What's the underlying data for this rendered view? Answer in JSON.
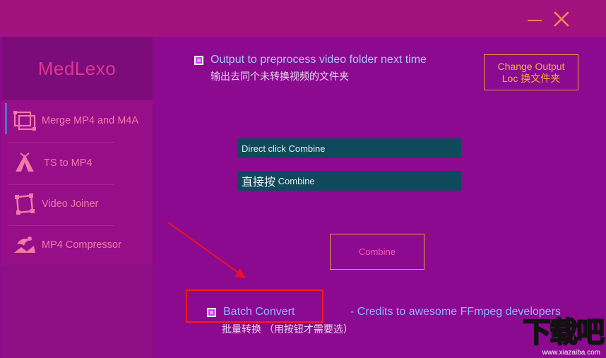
{
  "window": {
    "minimize_icon": "minimize-icon",
    "close_icon": "close-icon"
  },
  "sidebar": {
    "logo": "MedLexo",
    "items": [
      {
        "label": "Merge MP4 and M4A",
        "icon": "merge-icon",
        "active": true
      },
      {
        "label": "TS to MP4",
        "icon": "tent-icon",
        "active": false
      },
      {
        "label": "Video Joiner",
        "icon": "joiner-icon",
        "active": false
      },
      {
        "label": "MP4 Compressor",
        "icon": "compressor-icon",
        "active": false
      }
    ]
  },
  "main": {
    "output_checkbox": {
      "label": "Output to preprocess video folder next time",
      "sublabel": "输出去同个未转换视频的文件夹",
      "checked": true
    },
    "change_output_button": {
      "line1": "Change Output",
      "line2": "Loc 换文件夹"
    },
    "input_field_1": {
      "value": "Direct click Combine"
    },
    "input_field_2": {
      "value_cn": "直接按",
      "value_en": " Combine"
    },
    "combine_button": {
      "label": "Combine"
    },
    "batch_checkbox": {
      "label": "Batch Convert",
      "sublabel": "批量转换 （用按钮才需要选）",
      "checked": true
    },
    "credits": "- Credits to awesome FFmpeg developers"
  },
  "watermark": {
    "text": "下载吧",
    "url": "www.xiazaiba.com"
  },
  "colors": {
    "background": "#8b0a8f",
    "titlebar": "#a3117f",
    "accent_orange": "#f2b23a",
    "teal": "#0f4a5c",
    "highlight_red": "#ff1a1a",
    "logo_pink": "#e0368e"
  }
}
